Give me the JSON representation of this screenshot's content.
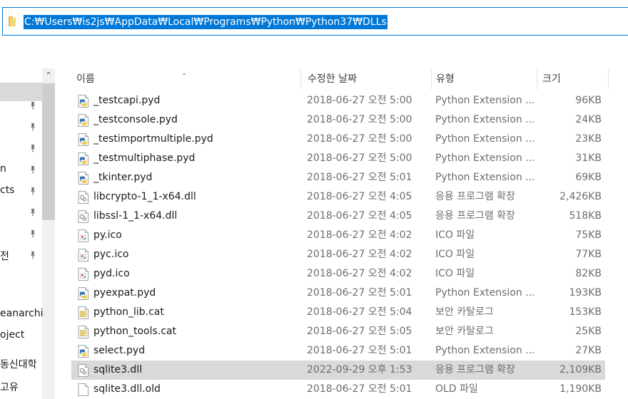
{
  "address_bar": {
    "path": "C:₩Users₩is2js₩AppData₩Local₩Programs₩Python₩Python37₩DLLs",
    "icon": "folder-icon"
  },
  "nav_pane": {
    "items": [
      {
        "label": "",
        "pinned": false
      },
      {
        "label": "",
        "pinned": true
      },
      {
        "label": "",
        "pinned": true
      },
      {
        "label": "",
        "pinned": true
      },
      {
        "label": "n",
        "pinned": true
      },
      {
        "label": "cts",
        "pinned": true
      },
      {
        "label": "",
        "pinned": true
      },
      {
        "label": "",
        "pinned": true
      },
      {
        "label": "전",
        "pinned": true
      },
      {
        "label": "eanarchi",
        "pinned": false
      },
      {
        "label": "oject",
        "pinned": false
      },
      {
        "label": "동신대학",
        "pinned": false
      },
      {
        "label": "고유",
        "pinned": false
      }
    ]
  },
  "columns": {
    "name": "이름",
    "date": "수정한 날짜",
    "type": "유형",
    "size": "크기"
  },
  "files": [
    {
      "name": "_testcapi.pyd",
      "date": "2018-06-27 오전 5:00",
      "type": "Python Extension ...",
      "size": "96KB",
      "icon": "python-file-icon"
    },
    {
      "name": "_testconsole.pyd",
      "date": "2018-06-27 오전 5:00",
      "type": "Python Extension ...",
      "size": "24KB",
      "icon": "python-file-icon"
    },
    {
      "name": "_testimportmultiple.pyd",
      "date": "2018-06-27 오전 5:00",
      "type": "Python Extension ...",
      "size": "23KB",
      "icon": "python-file-icon"
    },
    {
      "name": "_testmultiphase.pyd",
      "date": "2018-06-27 오전 5:00",
      "type": "Python Extension ...",
      "size": "31KB",
      "icon": "python-file-icon"
    },
    {
      "name": "_tkinter.pyd",
      "date": "2018-06-27 오전 5:01",
      "type": "Python Extension ...",
      "size": "69KB",
      "icon": "python-file-icon"
    },
    {
      "name": "libcrypto-1_1-x64.dll",
      "date": "2018-06-27 오전 4:05",
      "type": "응용 프로그램 확장",
      "size": "2,426KB",
      "icon": "dll-file-icon"
    },
    {
      "name": "libssl-1_1-x64.dll",
      "date": "2018-06-27 오전 4:05",
      "type": "응용 프로그램 확장",
      "size": "518KB",
      "icon": "dll-file-icon"
    },
    {
      "name": "py.ico",
      "date": "2018-06-27 오전 4:02",
      "type": "ICO 파일",
      "size": "75KB",
      "icon": "ico-file-icon"
    },
    {
      "name": "pyc.ico",
      "date": "2018-06-27 오전 4:02",
      "type": "ICO 파일",
      "size": "77KB",
      "icon": "ico-file-icon"
    },
    {
      "name": "pyd.ico",
      "date": "2018-06-27 오전 4:02",
      "type": "ICO 파일",
      "size": "82KB",
      "icon": "ico-file-icon"
    },
    {
      "name": "pyexpat.pyd",
      "date": "2018-06-27 오전 5:01",
      "type": "Python Extension ...",
      "size": "193KB",
      "icon": "python-file-icon"
    },
    {
      "name": "python_lib.cat",
      "date": "2018-06-27 오전 5:04",
      "type": "보안 카탈로그",
      "size": "153KB",
      "icon": "catalog-file-icon"
    },
    {
      "name": "python_tools.cat",
      "date": "2018-06-27 오전 5:05",
      "type": "보안 카탈로그",
      "size": "25KB",
      "icon": "catalog-file-icon"
    },
    {
      "name": "select.pyd",
      "date": "2018-06-27 오전 5:01",
      "type": "Python Extension ...",
      "size": "27KB",
      "icon": "python-file-icon"
    },
    {
      "name": "sqlite3.dll",
      "date": "2022-09-29 오후 1:53",
      "type": "응용 프로그램 확장",
      "size": "2,109KB",
      "icon": "dll-file-icon",
      "selected": true
    },
    {
      "name": "sqlite3.dll.old",
      "date": "2018-06-27 오전 5:01",
      "type": "OLD 파일",
      "size": "1,190KB",
      "icon": "blank-file-icon"
    }
  ],
  "colors": {
    "accent": "#0078d7",
    "selected_row": "#d9d9d9",
    "python_blue": "#3b73b0",
    "python_yellow": "#f2c94c"
  }
}
